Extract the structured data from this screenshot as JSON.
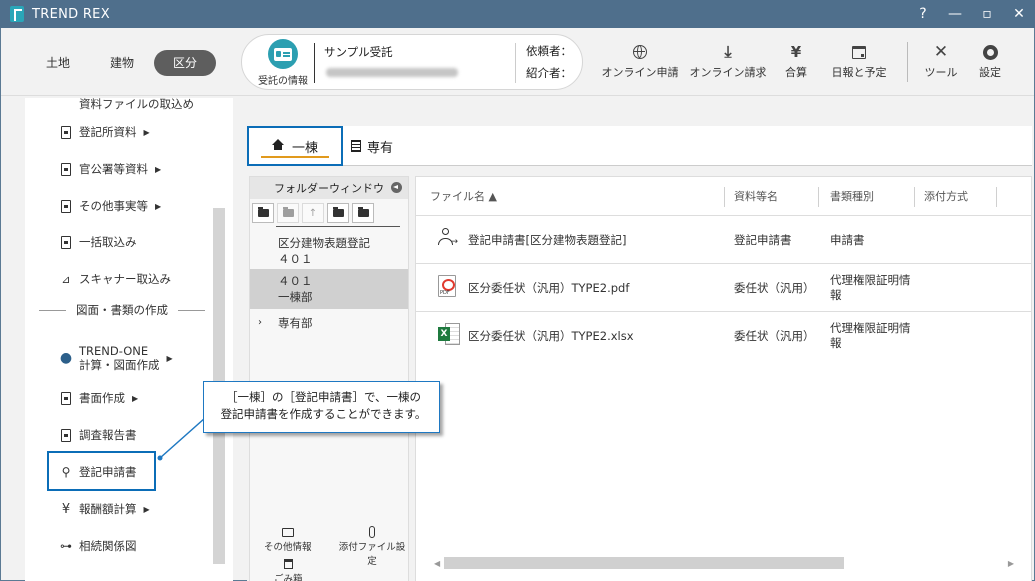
{
  "window": {
    "title": "TREND REX",
    "help": "?",
    "minimize": "—",
    "maximize": "▫",
    "close": "✕"
  },
  "toolbar": {
    "modes": [
      {
        "label": "土地",
        "active": false
      },
      {
        "label": "建物",
        "active": false
      },
      {
        "label": "区分",
        "active": true
      }
    ],
    "case": {
      "icon_label": "受託の情報",
      "name": "サンプル受託",
      "client_label": "依頼者：",
      "introducer_label": "紹介者："
    },
    "tools": [
      {
        "label": "オンライン申請",
        "icon": "globe-icon"
      },
      {
        "label": "オンライン請求",
        "icon": "download-icon"
      },
      {
        "label": "合算",
        "icon": "yen-icon"
      },
      {
        "label": "日報と予定",
        "icon": "calendar-icon"
      },
      {
        "label": "ツール",
        "icon": "tools-icon"
      },
      {
        "label": "設定",
        "icon": "gear-icon"
      }
    ]
  },
  "sidebar": {
    "cutoff_item": "資料ファイルの取込め",
    "items": [
      {
        "label": "登記所資料",
        "icon": "document-icon",
        "arrow": true
      },
      {
        "label": "官公署等資料",
        "icon": "document-icon",
        "arrow": true
      },
      {
        "label": "その他事実等",
        "icon": "document-icon",
        "arrow": true
      },
      {
        "label": "一括取込み",
        "icon": "import-icon",
        "arrow": false
      },
      {
        "label": "スキャナー取込み",
        "icon": "scanner-icon",
        "arrow": false
      }
    ],
    "section_title": "図面・書類の作成",
    "items2": [
      {
        "label": "TREND-ONE",
        "label2": "計算・図面作成",
        "icon": "trend-one-icon",
        "arrow": true
      },
      {
        "label": "書面作成",
        "icon": "edit-document-icon",
        "arrow": true
      },
      {
        "label": "調査報告書",
        "icon": "report-icon",
        "arrow": false
      },
      {
        "label": "登記申請書",
        "icon": "person-arrow-icon",
        "arrow": false
      },
      {
        "label": "報酬額計算",
        "icon": "yen-icon",
        "arrow": true
      },
      {
        "label": "相続関係図",
        "icon": "tree-icon",
        "arrow": false
      }
    ]
  },
  "callout": {
    "line1": "［一棟］の［登記申請書］で、一棟の",
    "line2": "登記申請書を作成することができます。"
  },
  "tabs": [
    {
      "label": "一棟",
      "icon": "home-icon",
      "active": true
    },
    {
      "label": "専有",
      "icon": "building-icon",
      "active": false
    }
  ],
  "folder_window": {
    "title": "フォルダーウィンドウ",
    "tree": [
      {
        "line1": "区分建物表題登記",
        "line2": "４０１",
        "selected": false
      },
      {
        "line1": "４０１",
        "line2": "一棟部",
        "selected": true
      },
      {
        "line1": "専有部",
        "line2": "",
        "selected": false,
        "expandable": true
      }
    ],
    "bottom": {
      "other_info": "その他情報",
      "attach_settings": "添付ファイル設定",
      "trash": "ごみ箱"
    }
  },
  "file_list": {
    "columns": [
      "ファイル名 ▲",
      "資料等名",
      "書類種別",
      "添付方式"
    ],
    "rows": [
      {
        "icon": "person-arrow-icon",
        "name": "登記申請書[区分建物表題登記]",
        "doc": "登記申請書",
        "type": "申請書",
        "type2": "",
        "attach": ""
      },
      {
        "icon": "pdf-icon",
        "name": "区分委任状（汎用）TYPE2.pdf",
        "doc": "委任状（汎用）",
        "type": "代理権限証明情",
        "type2": "報",
        "attach": ""
      },
      {
        "icon": "excel-icon",
        "name": "区分委任状（汎用）TYPE2.xlsx",
        "doc": "委任状（汎用）",
        "type": "代理権限証明情",
        "type2": "報",
        "attach": ""
      }
    ]
  }
}
